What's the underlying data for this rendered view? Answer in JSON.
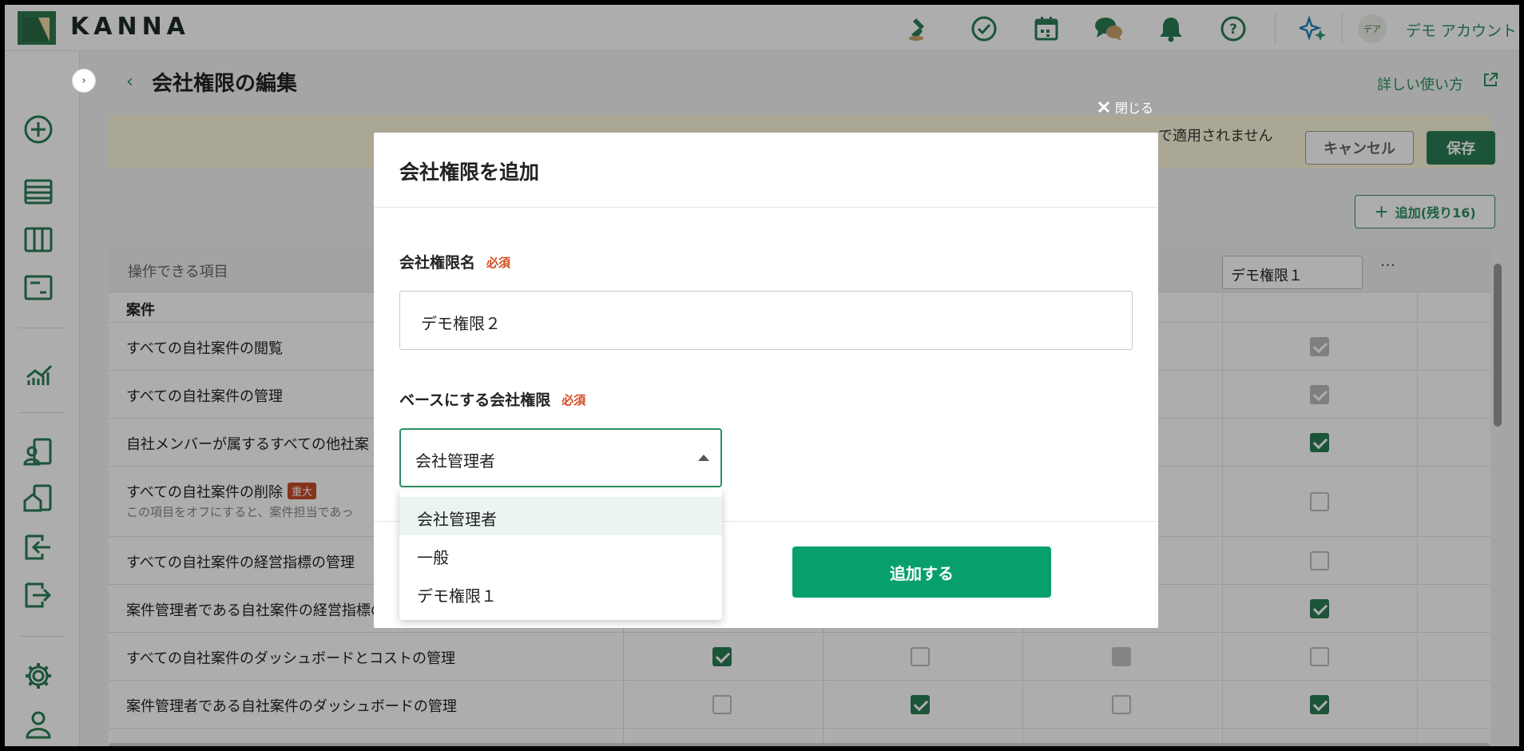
{
  "app": {
    "logo_text": "KANNA"
  },
  "header": {
    "icons": [
      "stamp-icon",
      "check-circle-icon",
      "calendar-icon",
      "chat-icon",
      "bell-icon",
      "help-icon",
      "sparkle-icon"
    ],
    "avatar_text": "デア",
    "account_name": "デモ アカウント",
    "accent_color": "#2c8f61"
  },
  "sidebar": {
    "icons": [
      "add-circle-icon",
      "list-icon",
      "board-icon",
      "document-icon",
      "chart-icon",
      "customer-icon",
      "property-icon",
      "inbound-icon",
      "outbound-icon",
      "settings-icon",
      "user-icon"
    ]
  },
  "page": {
    "back_label": "‹",
    "title": "会社権限の編集",
    "help_link": "詳しい使い方",
    "notice_text": "で適用されません",
    "cancel_label": "キャンセル",
    "save_label": "保存",
    "add_column_label": "追加(残り16)"
  },
  "table": {
    "header_label": "操作できる項目",
    "column_name_value": "デモ権限１",
    "more_label": "···",
    "section": "案件",
    "rows": [
      {
        "label": "すべての自社案件の閲覧",
        "note": "",
        "badge": ""
      },
      {
        "label": "すべての自社案件の管理",
        "note": "",
        "badge": ""
      },
      {
        "label": "自社メンバーが属するすべての他社案",
        "note": "",
        "badge": ""
      },
      {
        "label": "すべての自社案件の削除",
        "note": "この項目をオフにすると、案件担当であっ",
        "badge": "重大"
      },
      {
        "label": "すべての自社案件の経営指標の管理",
        "note": "",
        "badge": ""
      },
      {
        "label": "案件管理者である自社案件の経営指標の管理",
        "note": "",
        "badge": ""
      },
      {
        "label": "すべての自社案件のダッシュボードとコストの管理",
        "note": "",
        "badge": ""
      },
      {
        "label": "案件管理者である自社案件のダッシュボードの管理",
        "note": "",
        "badge": ""
      }
    ]
  },
  "modal": {
    "close_label": "閉じる",
    "title": "会社権限を追加",
    "name_label": "会社権限名",
    "required_label": "必須",
    "name_value": "デモ権限２",
    "base_label": "ベースにする会社権限",
    "base_selected": "会社管理者",
    "options": [
      "会社管理者",
      "一般",
      "デモ権限１"
    ],
    "submit_label": "追加する"
  }
}
